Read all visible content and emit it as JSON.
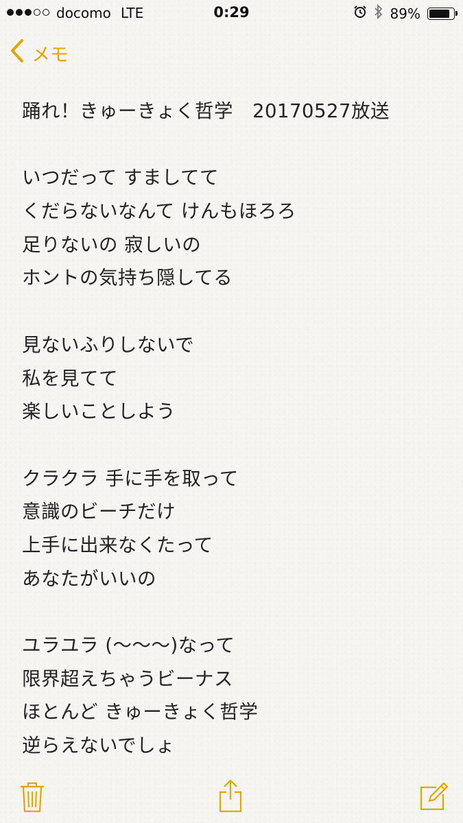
{
  "status_bar": {
    "carrier": "docomo",
    "network": "LTE",
    "time": "0:29",
    "battery": "89%",
    "battery_level": 0.89,
    "signal_filled": 3,
    "signal_total": 5
  },
  "nav": {
    "back_label": "メモ"
  },
  "note": {
    "title": "踊れ！きゅーきょく哲学　20170527放送",
    "stanzas": [
      [
        "いつだって すましてて",
        "くだらないなんて けんもほろろ",
        "足りないの 寂しいの",
        "ホントの気持ち隠してる"
      ],
      [
        "見ないふりしないで",
        "私を見てて",
        "楽しいことしよう"
      ],
      [
        "クラクラ 手に手を取って",
        "意識のビーチだけ",
        "上手に出来なくたって",
        "あなたがいいの"
      ],
      [
        "ユラユラ (〜〜〜)なって",
        "限界超えちゃうビーナス",
        "ほとんど きゅーきょく哲学",
        "逆らえないでしょ"
      ]
    ]
  },
  "icons": {
    "accent": "#e3a500",
    "back": "chevron-left-icon",
    "trash": "trash-icon",
    "share": "share-icon",
    "compose": "compose-icon"
  }
}
